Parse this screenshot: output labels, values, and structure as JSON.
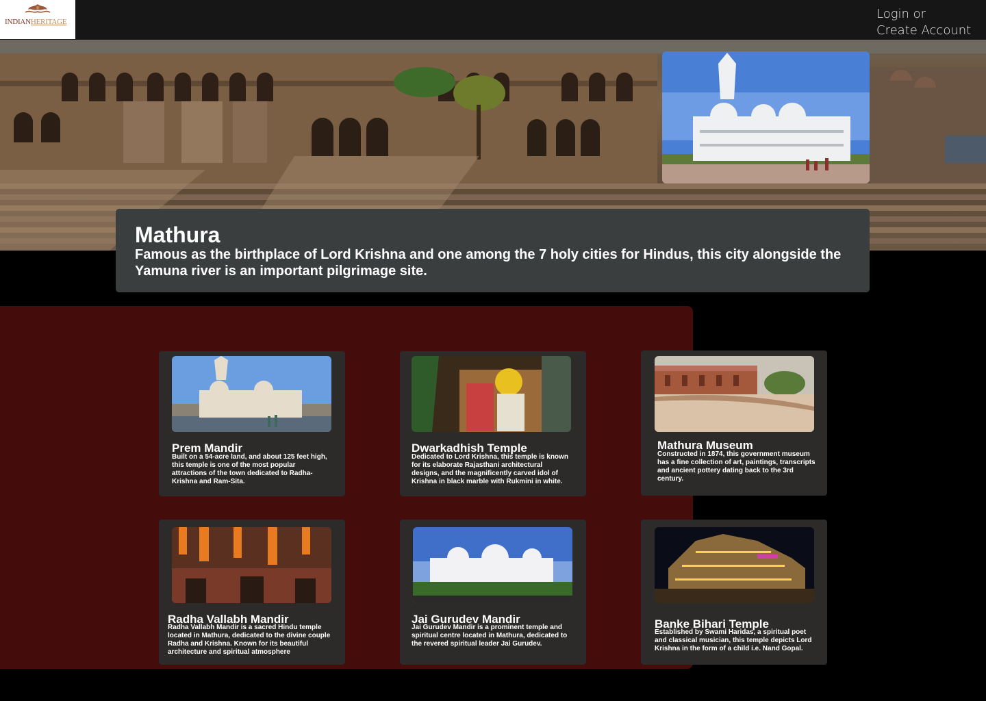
{
  "header": {
    "logo": {
      "word1": "INDIAN",
      "word2": "HERITAGE"
    },
    "auth": {
      "login": "Login or",
      "create": "Create Account"
    }
  },
  "hero": {
    "title": "Mathura",
    "description": "Famous as the birthplace of Lord Krishna and one among the 7 holy cities for Hindus, this city alongside the Yamuna river is an important pilgrimage site."
  },
  "places": [
    {
      "name": "Prem Mandir",
      "description": "Built on a 54-acre land, and about 125 feet high, this temple is one of the most popular attractions of the town dedicated to Radha-Krishna and Ram-Sita."
    },
    {
      "name": "Dwarkadhish Temple",
      "description": "Dedicated to Lord Krishna, this temple is known for its elaborate Rajasthani architectural designs, and the magnificently carved idol of Krishna in black marble with Rukmini in white."
    },
    {
      "name": "Mathura Museum",
      "description": "Constructed in 1874, this government museum has a fine collection of art, paintings, transcripts and ancient pottery dating back to the 3rd century."
    },
    {
      "name": "Radha Vallabh Mandir",
      "description": "Radha Vallabh Mandir is a sacred Hindu temple located in Mathura, dedicated to the divine couple Radha and Krishna. Known for its beautiful architecture and spiritual atmosphere"
    },
    {
      "name": "Jai Gurudev Mandir",
      "description": "Jai Gurudev Mandir is a prominent temple and spiritual centre located in Mathura, dedicated to the revered spiritual leader Jai Gurudev."
    },
    {
      "name": "Banke Bihari Temple",
      "description": "Established by Swami Haridas, a spiritual poet and classical musician, this temple depicts Lord Krishna in the form of a child i.e. Nand Gopal."
    }
  ],
  "colors": {
    "topbar": "#161616",
    "title_card": "#3b3e3f",
    "panel": "#450c0c",
    "card": "#2d2b2a"
  }
}
